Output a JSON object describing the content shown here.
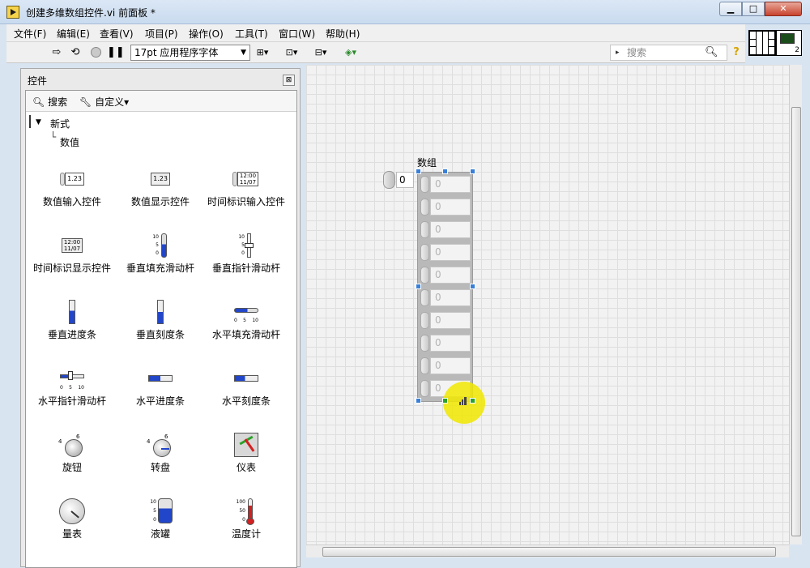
{
  "window": {
    "title": "创建多维数组控件.vi 前面板 *",
    "buttons": {
      "minimize": "▁",
      "maximize": "□",
      "close": "✕"
    }
  },
  "menu": [
    "文件(F)",
    "编辑(E)",
    "查看(V)",
    "项目(P)",
    "操作(O)",
    "工具(T)",
    "窗口(W)",
    "帮助(H)"
  ],
  "toolbar": {
    "font": "17pt 应用程序字体",
    "search_placeholder": "搜索",
    "icons": [
      "run-arrow-icon",
      "run-continuously-icon",
      "abort-icon",
      "pause-icon",
      "align-icon",
      "distribute-icon",
      "resize-icon",
      "reorder-icon",
      "search-icon",
      "help-icon"
    ],
    "vi_icon_number": "2"
  },
  "palette": {
    "title": "控件",
    "close": "⊠",
    "search_label": "搜索",
    "customize_label": "自定义▾",
    "tree_root": "新式",
    "tree_child": "数值",
    "items": [
      {
        "label": "数值输入控件",
        "icon": "numeric-control-icon"
      },
      {
        "label": "数值显示控件",
        "icon": "numeric-indicator-icon"
      },
      {
        "label": "时间标识输入控件",
        "icon": "timestamp-control-icon"
      },
      {
        "label": "时间标识显示控件",
        "icon": "timestamp-indicator-icon"
      },
      {
        "label": "垂直填充滑动杆",
        "icon": "vertical-fill-slide-icon"
      },
      {
        "label": "垂直指针滑动杆",
        "icon": "vertical-pointer-slide-icon"
      },
      {
        "label": "垂直进度条",
        "icon": "vertical-progress-bar-icon"
      },
      {
        "label": "垂直刻度条",
        "icon": "vertical-graduated-bar-icon"
      },
      {
        "label": "水平填充滑动杆",
        "icon": "horizontal-fill-slide-icon"
      },
      {
        "label": "水平指针滑动杆",
        "icon": "horizontal-pointer-slide-icon"
      },
      {
        "label": "水平进度条",
        "icon": "horizontal-progress-bar-icon"
      },
      {
        "label": "水平刻度条",
        "icon": "horizontal-graduated-bar-icon"
      },
      {
        "label": "旋钮",
        "icon": "knob-icon"
      },
      {
        "label": "转盘",
        "icon": "dial-icon"
      },
      {
        "label": "仪表",
        "icon": "gauge-icon"
      },
      {
        "label": "量表",
        "icon": "meter-icon"
      },
      {
        "label": "液罐",
        "icon": "tank-icon"
      },
      {
        "label": "温度计",
        "icon": "thermometer-icon"
      }
    ],
    "item_texts": {
      "numeric": "1.23",
      "timestamp": "12:00\n11/07",
      "knob_scale": [
        "4",
        "6"
      ],
      "tank_scale": [
        "10",
        "5",
        "0"
      ],
      "thermo_scale": [
        "100",
        "50",
        "0"
      ],
      "hslide_scale": [
        "0",
        "5",
        "10"
      ],
      "vslide_scale": [
        "10",
        "5",
        "0"
      ]
    }
  },
  "front_panel": {
    "array_label": "数组",
    "index_value": "0",
    "element_values": [
      "0",
      "0",
      "0",
      "0",
      "0",
      "0",
      "0",
      "0",
      "0",
      "0"
    ]
  }
}
